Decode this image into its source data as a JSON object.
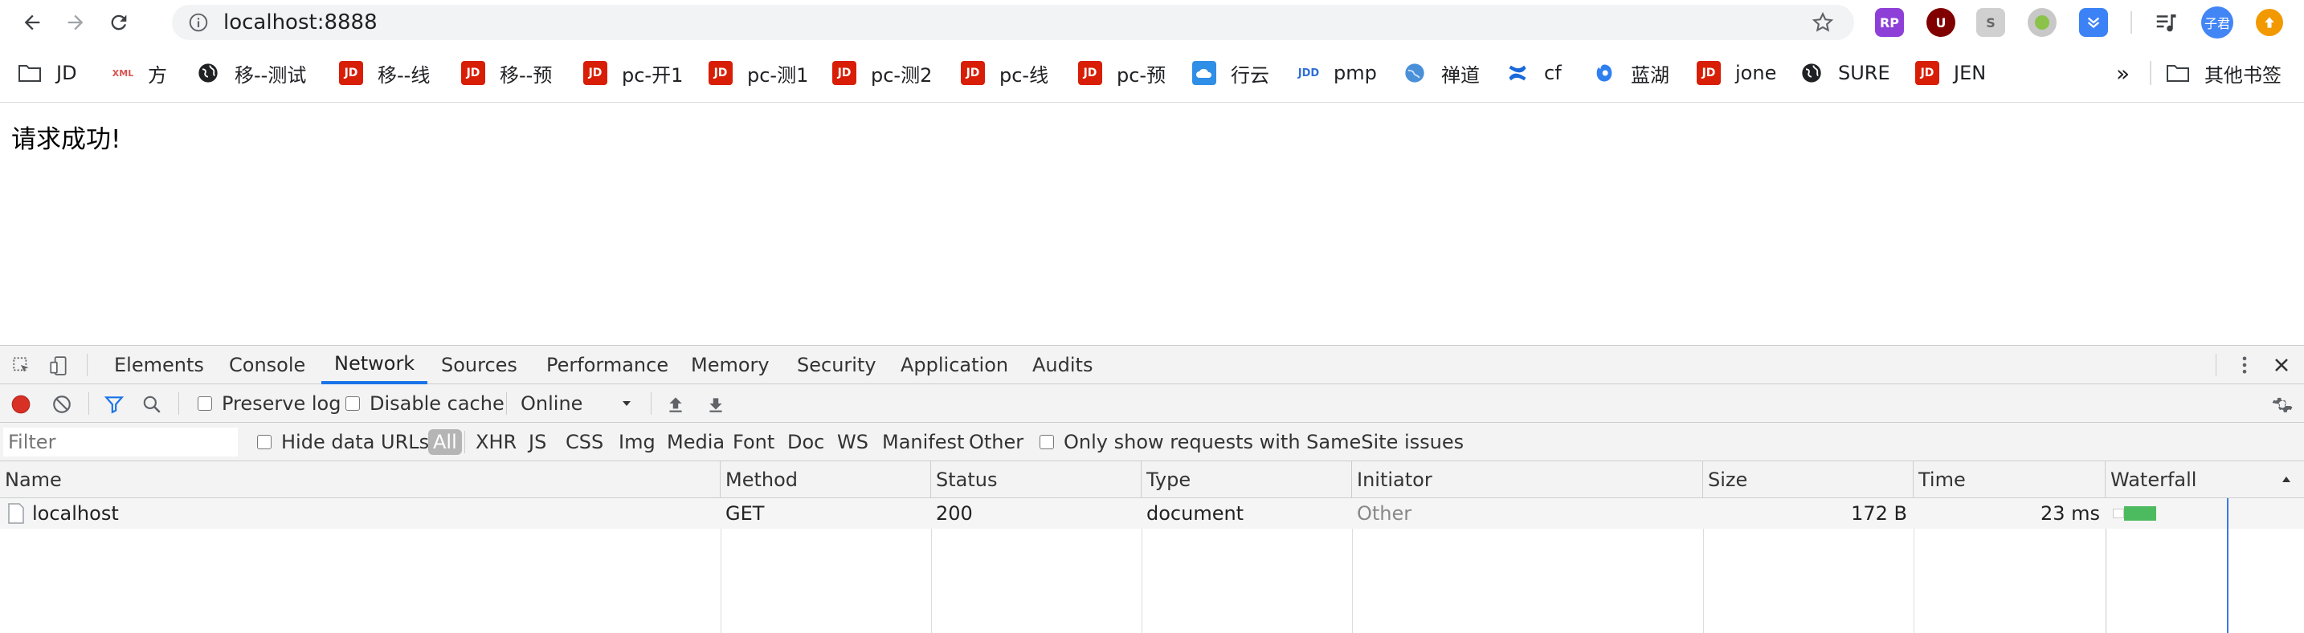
{
  "browser": {
    "url": "localhost:8888",
    "extensions": [
      {
        "name": "rp-extension-icon",
        "label": "RP",
        "color": "#8e3fd8"
      },
      {
        "name": "ublock-icon",
        "label": "U",
        "color": "#800000"
      },
      {
        "name": "s-extension-icon",
        "label": "S",
        "color": "#c9c9c9"
      },
      {
        "name": "green-circle-extension-icon",
        "label": "",
        "color": "#8bc34a"
      },
      {
        "name": "download-extension-icon",
        "label": "",
        "color": "#3b82f6"
      }
    ],
    "profile": {
      "label": "子君",
      "color": "#4285f4"
    },
    "update_color": "#f29900"
  },
  "bookmarks": [
    {
      "label": "JD",
      "icon": "folder-icon"
    },
    {
      "label": "方",
      "icon": "xml-icon"
    },
    {
      "label": "移--测试",
      "icon": "globe-icon"
    },
    {
      "label": "移--线",
      "icon": "jd-icon"
    },
    {
      "label": "移--预",
      "icon": "jd-icon"
    },
    {
      "label": "pc-开1",
      "icon": "jd-icon"
    },
    {
      "label": "pc-测1",
      "icon": "jd-icon"
    },
    {
      "label": "pc-测2",
      "icon": "jd-icon"
    },
    {
      "label": "pc-线",
      "icon": "jd-icon"
    },
    {
      "label": "pc-预",
      "icon": "jd-icon"
    },
    {
      "label": "行云",
      "icon": "cloud-icon"
    },
    {
      "label": "pmp",
      "icon": "jdd-icon"
    },
    {
      "label": "禅道",
      "icon": "globe-blue-icon"
    },
    {
      "label": "cf",
      "icon": "confluence-icon"
    },
    {
      "label": "蓝湖",
      "icon": "lanhu-icon"
    },
    {
      "label": "jone",
      "icon": "jd-icon"
    },
    {
      "label": "SURE",
      "icon": "globe-icon"
    },
    {
      "label": "JEN",
      "icon": "jd-icon"
    }
  ],
  "bookmarks_overflow": "»",
  "other_bookmarks": "其他书签",
  "jd_icon_text": "JD",
  "xml_icon_text": "XML",
  "jdd_icon_text": "JDD",
  "page": {
    "message": "请求成功!"
  },
  "devtools": {
    "tabs": [
      "Elements",
      "Console",
      "Network",
      "Sources",
      "Performance",
      "Memory",
      "Security",
      "Application",
      "Audits"
    ],
    "active_tab": "Network",
    "preserve_log": "Preserve log",
    "disable_cache": "Disable cache",
    "throttling": "Online",
    "filter_placeholder": "Filter",
    "hide_data_urls": "Hide data URLs",
    "type_filters": [
      "All",
      "XHR",
      "JS",
      "CSS",
      "Img",
      "Media",
      "Font",
      "Doc",
      "WS",
      "Manifest",
      "Other"
    ],
    "samesite": "Only show requests with SameSite issues",
    "columns": [
      "Name",
      "Method",
      "Status",
      "Type",
      "Initiator",
      "Size",
      "Time",
      "Waterfall"
    ],
    "requests": [
      {
        "name": "localhost",
        "method": "GET",
        "status": "200",
        "type": "document",
        "initiator": "Other",
        "size": "172 B",
        "time": "23 ms"
      }
    ]
  }
}
